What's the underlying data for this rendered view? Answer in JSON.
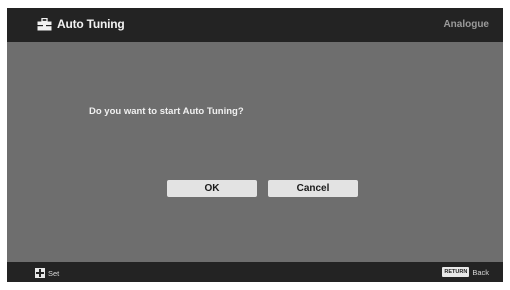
{
  "header": {
    "title": "Auto Tuning",
    "icon": "toolbox-icon",
    "mode": "Analogue"
  },
  "dialog": {
    "message": "Do you want to start Auto Tuning?",
    "ok_label": "OK",
    "cancel_label": "Cancel"
  },
  "footer": {
    "left_icon": "dpad-icon",
    "left_label": "Set",
    "return_key_label": "RETURN",
    "right_label": "Back"
  },
  "colors": {
    "background": "#6e6e6e",
    "bar": "#232323",
    "button": "#e3e3e3"
  }
}
